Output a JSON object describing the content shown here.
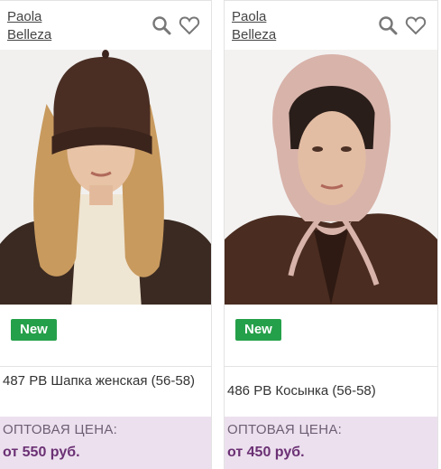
{
  "products": [
    {
      "brand_line1": "Paola",
      "brand_line2": "Belleza",
      "badge": "New",
      "name": "487 PB Шапка женская (56-58)",
      "price_label": "ОПТОВАЯ ЦЕНА:",
      "price": "от 550 руб."
    },
    {
      "brand_line1": "Paola",
      "brand_line2": "Belleza",
      "badge": "New",
      "name": "486 PB Косынка (56-58)",
      "price_label": "ОПТОВАЯ ЦЕНА:",
      "price": "от 450 руб."
    }
  ],
  "icons": [
    "search-icon",
    "heart-icon"
  ],
  "colors": {
    "badge": "#25a04a",
    "price_bg": "#ece0ee",
    "price_text": "#6b3074"
  }
}
